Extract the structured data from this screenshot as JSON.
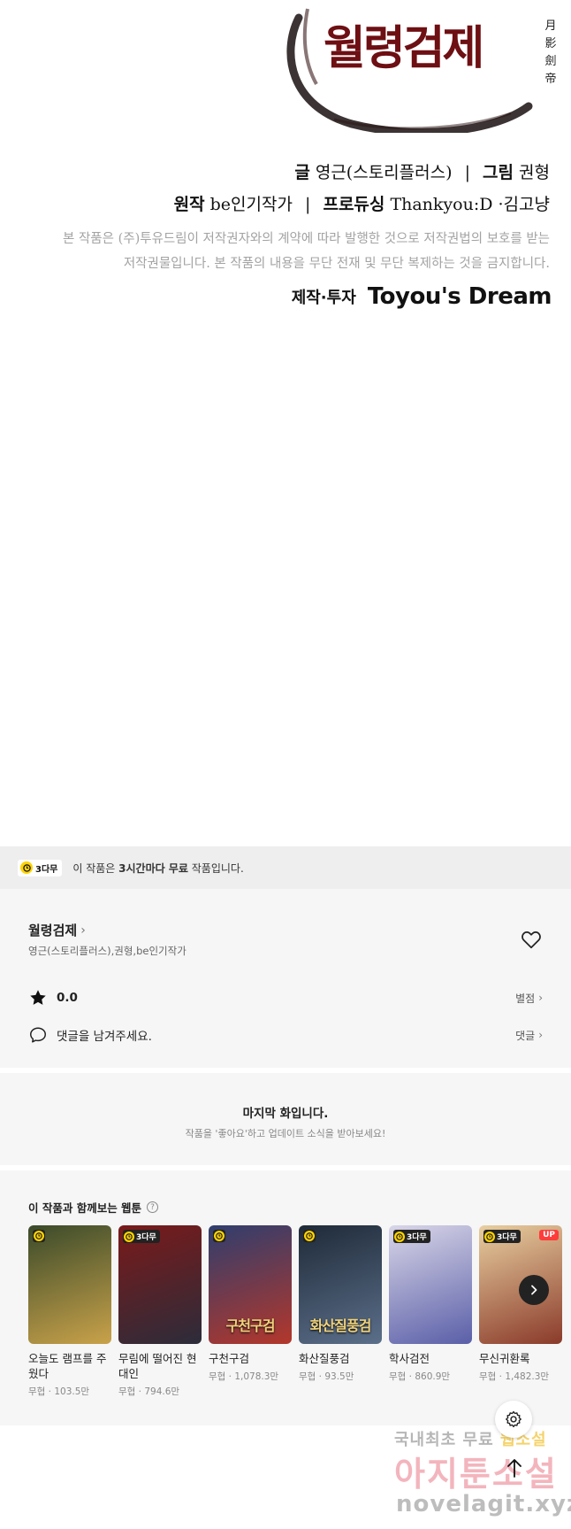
{
  "credits": {
    "logo_text": "월령검제",
    "logo_hanja": "月影劍帝",
    "writer_label": "글",
    "writer": "영근(스토리플러스)",
    "artist_label": "그림",
    "artist": "권형",
    "original_label": "원작",
    "original": "be인기작가",
    "producing_label": "프로듀싱",
    "producing": "Thankyou:D ·김고냥",
    "separator": "|",
    "notice_line1": "본 작품은 (주)투유드림이 저작권자와의 계약에 따라 발행한 것으로 저작권법의 보호를 받는",
    "notice_line2": "저작권물입니다. 본 작품의 내용을 무단 전재 및 무단 복제하는 것을 금지합니다.",
    "maker_label": "제작·투자",
    "maker_brand": "Toyou's Dream"
  },
  "free_banner": {
    "badge": "3다무",
    "text_before": "이 작품은 ",
    "text_bold": "3시간마다 무료",
    "text_after": " 작품입니다."
  },
  "series": {
    "title": "월령검제",
    "authors": "영근(스토리플러스),권형,be인기작가",
    "rating": "0.0",
    "rating_link": "별점",
    "comment_prompt": "댓글을 남겨주세요.",
    "comment_link": "댓글"
  },
  "last_episode": {
    "title": "마지막 화입니다.",
    "subtitle": "작품을 '좋아요'하고 업데이트 소식을 받아보세요!"
  },
  "recommendations": {
    "title": "이 작품과 함께보는 웹툰",
    "items": [
      {
        "title": "오늘도 램프를 주웠다",
        "meta": "무협 · 103.5만",
        "badge": "",
        "up": "",
        "art": "",
        "colors": [
          "#3a4a2a",
          "#c9a24a"
        ]
      },
      {
        "title": "무림에 떨어진 현대인",
        "meta": "무협 · 794.6만",
        "badge": "3다무",
        "up": "",
        "art": "",
        "colors": [
          "#7a1a1a",
          "#2c2c3a"
        ]
      },
      {
        "title": "구천구검",
        "meta": "무협 · 1,078.3만",
        "badge": "",
        "up": "",
        "art": "구천구검",
        "colors": [
          "#2f3e6e",
          "#b3372b"
        ]
      },
      {
        "title": "화산질풍검",
        "meta": "무협 · 93.5만",
        "badge": "",
        "up": "",
        "art": "화산질풍검",
        "colors": [
          "#1f2a38",
          "#5b6f8a"
        ]
      },
      {
        "title": "학사검전",
        "meta": "무협 · 860.9만",
        "badge": "3다무",
        "up": "",
        "art": "",
        "colors": [
          "#d9d6e8",
          "#5a5fa8"
        ]
      },
      {
        "title": "무신귀환록",
        "meta": "무협 · 1,482.3만",
        "badge": "3다무",
        "up": "UP",
        "art": "",
        "colors": [
          "#e8cfa0",
          "#8a3a2a"
        ]
      }
    ]
  },
  "watermark": {
    "line1_a": "국내최초 무료 ",
    "line1_b": "웹소설",
    "line2": "아지툰소설",
    "line3": "novelagit.xyz"
  },
  "colors": {
    "accent_yellow": "#ffd400",
    "up_red": "#ff3b3b",
    "logo_red": "#6e0f13"
  },
  "icons": [
    "clock-icon",
    "chevron-right-icon",
    "heart-icon",
    "star-icon",
    "comment-icon",
    "help-icon",
    "gear-icon",
    "arrow-up-icon"
  ]
}
